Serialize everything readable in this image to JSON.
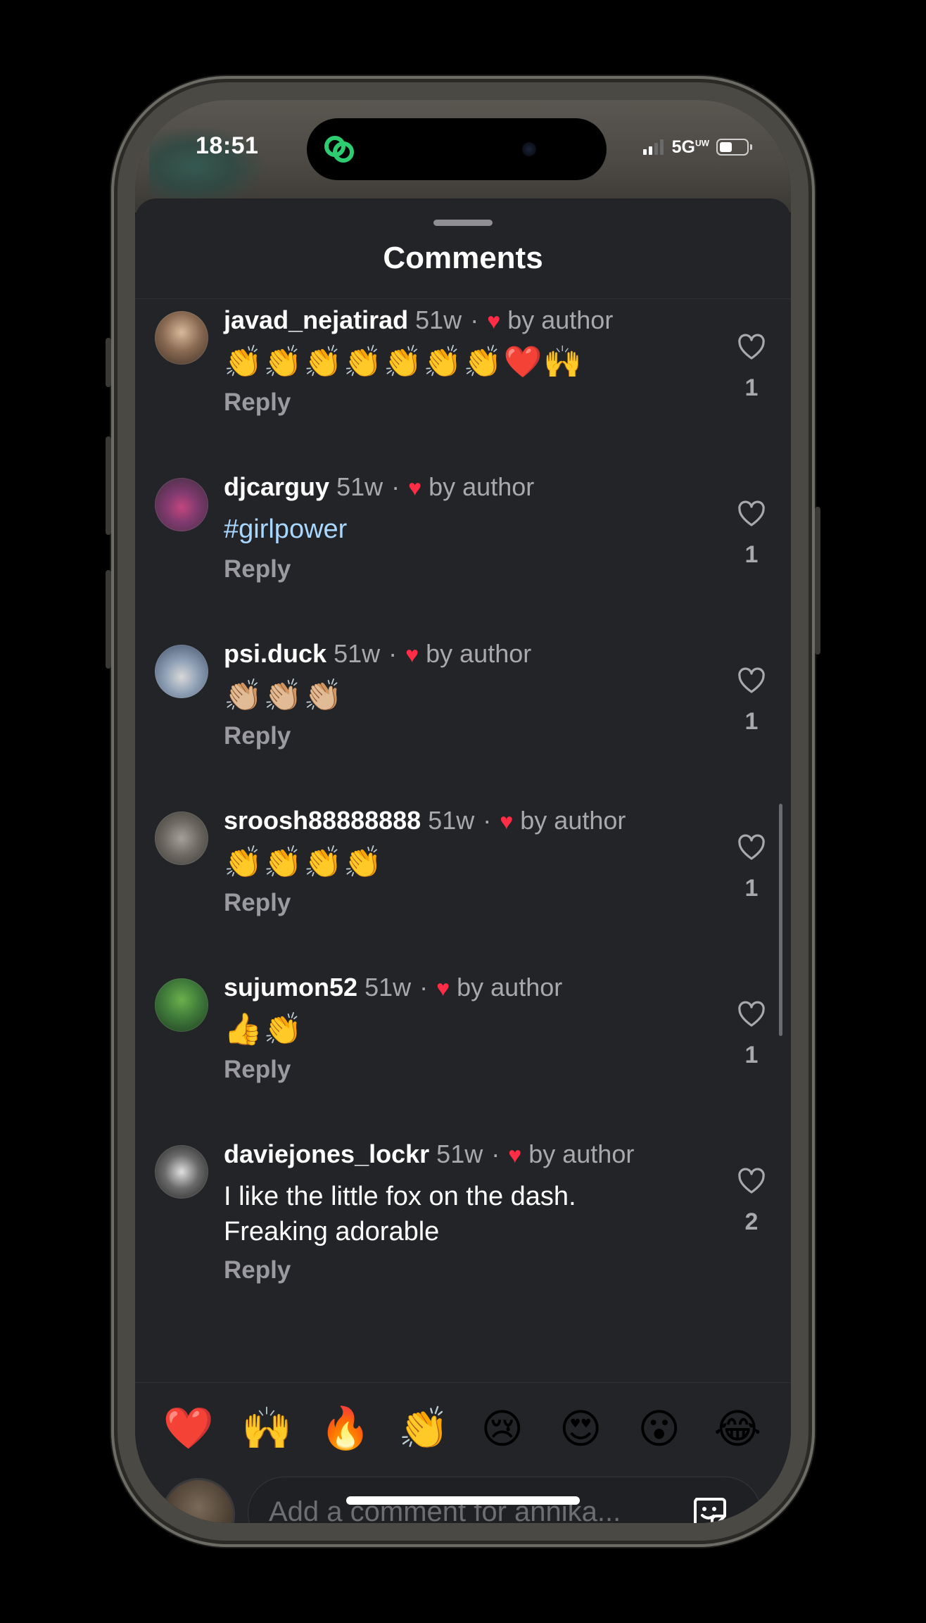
{
  "status_bar": {
    "time": "18:51",
    "network": "5G",
    "network_suffix": "UW"
  },
  "sheet": {
    "title": "Comments"
  },
  "comments": [
    {
      "username": "javad_nejatirad",
      "age": "51w",
      "author_like": "by author",
      "text": "👏👏👏👏👏👏👏❤️🙌",
      "style": "emoji",
      "reply": "Reply",
      "likes": "1"
    },
    {
      "username": "djcarguy",
      "age": "51w",
      "author_like": "by author",
      "text": "#girlpower",
      "style": "link",
      "reply": "Reply",
      "likes": "1"
    },
    {
      "username": "psi.duck",
      "age": "51w",
      "author_like": "by author",
      "text": "👏🏼👏🏼👏🏼",
      "style": "emoji",
      "reply": "Reply",
      "likes": "1"
    },
    {
      "username": "sroosh88888888",
      "age": "51w",
      "author_like": "by author",
      "text": "👏👏👏👏",
      "style": "emoji",
      "reply": "Reply",
      "likes": "1"
    },
    {
      "username": "sujumon52",
      "age": "51w",
      "author_like": "by author",
      "text": "👍👏",
      "style": "emoji",
      "reply": "Reply",
      "likes": "1"
    },
    {
      "username": "daviejones_lockr",
      "age": "51w",
      "author_like": "by author",
      "text": "I like the little fox on the dash. Freaking adorable",
      "style": "text",
      "reply": "Reply",
      "likes": "2"
    }
  ],
  "quick_reactions": [
    "❤️",
    "🙌",
    "🔥",
    "👏",
    "😢",
    "😍",
    "😮",
    "😂"
  ],
  "composer": {
    "placeholder": "Add a comment for annika..."
  },
  "icons": {
    "like": "heart-outline-icon",
    "author_heart": "heart-filled-icon",
    "sticker": "sticker-icon",
    "threads": "threads-icon"
  },
  "colors": {
    "background": "#232427",
    "accent_heart": "#ff2d45",
    "hashtag": "#a8d7ff",
    "threads_green": "#2ecc71"
  }
}
